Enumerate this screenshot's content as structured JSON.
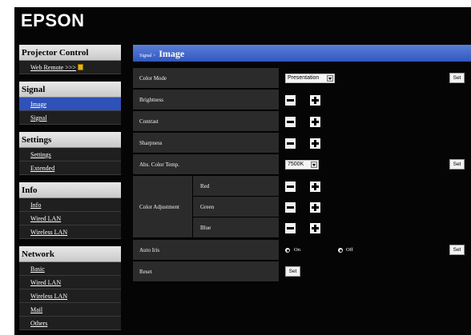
{
  "brand": "EPSON",
  "sidebar": {
    "sections": [
      {
        "title": "Projector Control",
        "items": [
          {
            "label": "Web Remote >>>",
            "active": false
          }
        ]
      },
      {
        "title": "Signal",
        "items": [
          {
            "label": "Image",
            "active": true
          },
          {
            "label": "Signal",
            "active": false
          }
        ]
      },
      {
        "title": "Settings",
        "items": [
          {
            "label": "Settings",
            "active": false
          },
          {
            "label": "Extended",
            "active": false
          }
        ]
      },
      {
        "title": "Info",
        "items": [
          {
            "label": "Info",
            "active": false
          },
          {
            "label": "Wired LAN",
            "active": false
          },
          {
            "label": "Wireless LAN",
            "active": false
          }
        ]
      },
      {
        "title": "Network",
        "items": [
          {
            "label": "Basic",
            "active": false
          },
          {
            "label": "Wired LAN",
            "active": false
          },
          {
            "label": "Wireless LAN",
            "active": false
          },
          {
            "label": "Mail",
            "active": false
          },
          {
            "label": "Others",
            "active": false
          }
        ]
      }
    ]
  },
  "content": {
    "breadcrumb": "Signal >",
    "title": "Image",
    "color_mode": {
      "label": "Color Mode",
      "value": "Presentation",
      "set_label": "Set"
    },
    "brightness": {
      "label": "Brightness"
    },
    "contrast": {
      "label": "Contrast"
    },
    "sharpness": {
      "label": "Sharpness"
    },
    "abs_color_temp": {
      "label": "Abs. Color Temp.",
      "value": "7500K",
      "set_label": "Set"
    },
    "color_adjustment": {
      "label": "Color Adjustment",
      "red": "Red",
      "green": "Green",
      "blue": "Blue"
    },
    "auto_iris": {
      "label": "Auto Iris",
      "on_label": "On",
      "off_label": "Off",
      "selected": "On",
      "set_label": "Set"
    },
    "reset": {
      "label": "Reset",
      "set_label": "Set"
    }
  },
  "icons": {
    "web_remote": "remote-control-icon",
    "minus": "minus-icon",
    "plus": "plus-icon"
  },
  "colors": {
    "accent": "#2f52b8",
    "header": "#3157c0",
    "background": "#050505"
  }
}
